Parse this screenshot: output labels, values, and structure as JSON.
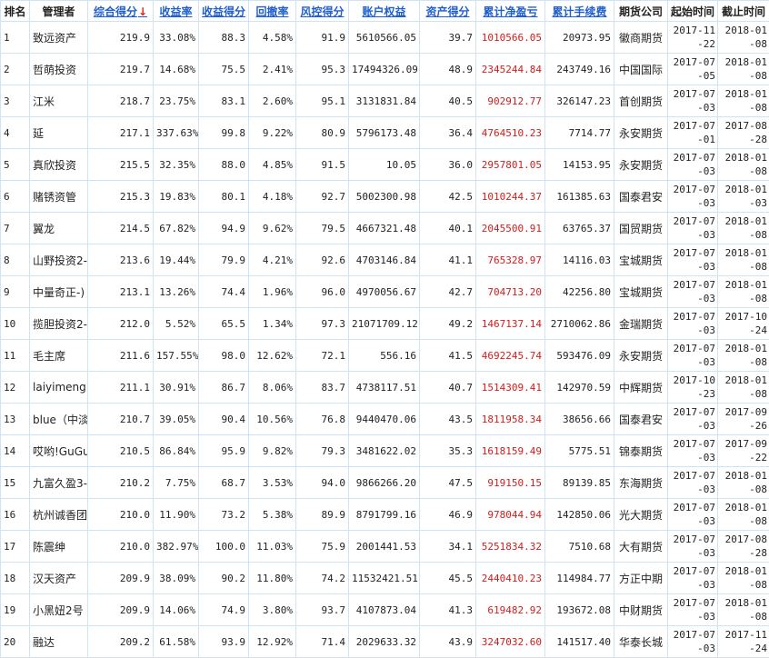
{
  "headers": [
    {
      "key": "rank",
      "label": "排名",
      "sortable": false
    },
    {
      "key": "manager",
      "label": "管理者",
      "sortable": false
    },
    {
      "key": "score",
      "label": "综合得分",
      "sortable": true,
      "arrow": "↓"
    },
    {
      "key": "return_rate",
      "label": "收益率",
      "sortable": true
    },
    {
      "key": "return_score",
      "label": "收益得分",
      "sortable": true
    },
    {
      "key": "drawdown",
      "label": "回撤率",
      "sortable": true
    },
    {
      "key": "risk_score",
      "label": "风控得分",
      "sortable": true
    },
    {
      "key": "account_equity",
      "label": "账户权益",
      "sortable": true
    },
    {
      "key": "asset_score",
      "label": "资产得分",
      "sortable": true
    },
    {
      "key": "cum_pnl",
      "label": "累计净盈亏",
      "sortable": true
    },
    {
      "key": "cum_fee",
      "label": "累计手续费",
      "sortable": true
    },
    {
      "key": "company",
      "label": "期货公司",
      "sortable": false
    },
    {
      "key": "start",
      "label": "起始时间",
      "sortable": false
    },
    {
      "key": "end",
      "label": "截止时间",
      "sortable": false
    }
  ],
  "rows": [
    {
      "rank": "1",
      "manager": "致远资产",
      "score": "219.9",
      "return_rate": "33.08%",
      "return_score": "88.3",
      "drawdown": "4.58%",
      "risk_score": "91.9",
      "account_equity": "5610566.05",
      "asset_score": "39.7",
      "cum_pnl": "1010566.05",
      "cum_fee": "20973.95",
      "company": "徽商期货",
      "start": "2017-11-22",
      "end": "2018-01-08"
    },
    {
      "rank": "2",
      "manager": "哲萌投资",
      "score": "219.7",
      "return_rate": "14.68%",
      "return_score": "75.5",
      "drawdown": "2.41%",
      "risk_score": "95.3",
      "account_equity": "17494326.09",
      "asset_score": "48.9",
      "cum_pnl": "2345244.84",
      "cum_fee": "243749.16",
      "company": "中国国际",
      "start": "2017-07-05",
      "end": "2018-01-08"
    },
    {
      "rank": "3",
      "manager": "江米",
      "score": "218.7",
      "return_rate": "23.75%",
      "return_score": "83.1",
      "drawdown": "2.60%",
      "risk_score": "95.1",
      "account_equity": "3131831.84",
      "asset_score": "40.5",
      "cum_pnl": "902912.77",
      "cum_fee": "326147.23",
      "company": "首创期货",
      "start": "2017-07-03",
      "end": "2018-01-08"
    },
    {
      "rank": "4",
      "manager": "延",
      "score": "217.1",
      "return_rate": "337.63%",
      "return_score": "99.8",
      "drawdown": "9.22%",
      "risk_score": "80.9",
      "account_equity": "5796173.48",
      "asset_score": "36.4",
      "cum_pnl": "4764510.23",
      "cum_fee": "7714.77",
      "company": "永安期货",
      "start": "2017-07-01",
      "end": "2017-08-28"
    },
    {
      "rank": "5",
      "manager": "真欣投资",
      "score": "215.5",
      "return_rate": "32.35%",
      "return_score": "88.0",
      "drawdown": "4.85%",
      "risk_score": "91.5",
      "account_equity": "10.05",
      "asset_score": "36.0",
      "cum_pnl": "2957801.05",
      "cum_fee": "14153.95",
      "company": "永安期货",
      "start": "2017-07-03",
      "end": "2018-01-08"
    },
    {
      "rank": "6",
      "manager": "赌锈资管",
      "score": "215.3",
      "return_rate": "19.83%",
      "return_score": "80.1",
      "drawdown": "4.18%",
      "risk_score": "92.7",
      "account_equity": "5002300.98",
      "asset_score": "42.5",
      "cum_pnl": "1010244.37",
      "cum_fee": "161385.63",
      "company": "国泰君安",
      "start": "2017-07-03",
      "end": "2018-01-03"
    },
    {
      "rank": "7",
      "manager": "翼龙",
      "score": "214.5",
      "return_rate": "67.82%",
      "return_score": "94.9",
      "drawdown": "9.62%",
      "risk_score": "79.5",
      "account_equity": "4667321.48",
      "asset_score": "40.1",
      "cum_pnl": "2045500.91",
      "cum_fee": "63765.37",
      "company": "国贸期货",
      "start": "2017-07-03",
      "end": "2018-01-08"
    },
    {
      "rank": "8",
      "manager": "山野投资2-",
      "score": "213.6",
      "return_rate": "19.44%",
      "return_score": "79.9",
      "drawdown": "4.21%",
      "risk_score": "92.6",
      "account_equity": "4703146.84",
      "asset_score": "41.1",
      "cum_pnl": "765328.97",
      "cum_fee": "14116.03",
      "company": "宝城期货",
      "start": "2017-07-03",
      "end": "2018-01-08"
    },
    {
      "rank": "9",
      "manager": "中量奇正-)",
      "score": "213.1",
      "return_rate": "13.26%",
      "return_score": "74.4",
      "drawdown": "1.96%",
      "risk_score": "96.0",
      "account_equity": "4970056.67",
      "asset_score": "42.7",
      "cum_pnl": "704713.20",
      "cum_fee": "42256.80",
      "company": "宝城期货",
      "start": "2017-07-03",
      "end": "2018-01-08"
    },
    {
      "rank": "10",
      "manager": "揽胆投资2-",
      "score": "212.0",
      "return_rate": "5.52%",
      "return_score": "65.5",
      "drawdown": "1.34%",
      "risk_score": "97.3",
      "account_equity": "21071709.12",
      "asset_score": "49.2",
      "cum_pnl": "1467137.14",
      "cum_fee": "2710062.86",
      "company": "金瑞期货",
      "start": "2017-07-03",
      "end": "2017-10-24"
    },
    {
      "rank": "11",
      "manager": "毛主席",
      "score": "211.6",
      "return_rate": "157.55%",
      "return_score": "98.0",
      "drawdown": "12.62%",
      "risk_score": "72.1",
      "account_equity": "556.16",
      "asset_score": "41.5",
      "cum_pnl": "4692245.74",
      "cum_fee": "593476.09",
      "company": "永安期货",
      "start": "2017-07-03",
      "end": "2018-01-08"
    },
    {
      "rank": "12",
      "manager": "laiyimeng.",
      "score": "211.1",
      "return_rate": "30.91%",
      "return_score": "86.7",
      "drawdown": "8.06%",
      "risk_score": "83.7",
      "account_equity": "4738117.51",
      "asset_score": "40.7",
      "cum_pnl": "1514309.41",
      "cum_fee": "142970.59",
      "company": "中辉期货",
      "start": "2017-10-23",
      "end": "2018-01-08"
    },
    {
      "rank": "13",
      "manager": "blue（中淡",
      "score": "210.7",
      "return_rate": "39.05%",
      "return_score": "90.4",
      "drawdown": "10.56%",
      "risk_score": "76.8",
      "account_equity": "9440470.06",
      "asset_score": "43.5",
      "cum_pnl": "1811958.34",
      "cum_fee": "38656.66",
      "company": "国泰君安",
      "start": "2017-07-03",
      "end": "2017-09-26"
    },
    {
      "rank": "14",
      "manager": "哎哟!GuGu",
      "score": "210.5",
      "return_rate": "86.84%",
      "return_score": "95.9",
      "drawdown": "9.82%",
      "risk_score": "79.3",
      "account_equity": "3481622.02",
      "asset_score": "35.3",
      "cum_pnl": "1618159.49",
      "cum_fee": "5775.51",
      "company": "锦泰期货",
      "start": "2017-07-03",
      "end": "2017-09-22"
    },
    {
      "rank": "15",
      "manager": "九富久盈3-",
      "score": "210.2",
      "return_rate": "7.75%",
      "return_score": "68.7",
      "drawdown": "3.53%",
      "risk_score": "94.0",
      "account_equity": "9866266.20",
      "asset_score": "47.5",
      "cum_pnl": "919150.15",
      "cum_fee": "89139.85",
      "company": "东海期货",
      "start": "2017-07-03",
      "end": "2018-01-08"
    },
    {
      "rank": "16",
      "manager": "杭州诚香团",
      "score": "210.0",
      "return_rate": "11.90%",
      "return_score": "73.2",
      "drawdown": "5.38%",
      "risk_score": "89.9",
      "account_equity": "8791799.16",
      "asset_score": "46.9",
      "cum_pnl": "978044.94",
      "cum_fee": "142850.06",
      "company": "光大期货",
      "start": "2017-07-03",
      "end": "2018-01-08"
    },
    {
      "rank": "17",
      "manager": "陈震绅",
      "score": "210.0",
      "return_rate": "382.97%",
      "return_score": "100.0",
      "drawdown": "11.03%",
      "risk_score": "75.9",
      "account_equity": "2001441.53",
      "asset_score": "34.1",
      "cum_pnl": "5251834.32",
      "cum_fee": "7510.68",
      "company": "大有期货",
      "start": "2017-07-03",
      "end": "2017-08-28"
    },
    {
      "rank": "18",
      "manager": "汉天资产",
      "score": "209.9",
      "return_rate": "38.09%",
      "return_score": "90.2",
      "drawdown": "11.80%",
      "risk_score": "74.2",
      "account_equity": "11532421.51",
      "asset_score": "45.5",
      "cum_pnl": "2440410.23",
      "cum_fee": "114984.77",
      "company": "方正中期",
      "start": "2017-07-03",
      "end": "2018-01-08"
    },
    {
      "rank": "19",
      "manager": "小黑妞2号",
      "score": "209.9",
      "return_rate": "14.06%",
      "return_score": "74.9",
      "drawdown": "3.80%",
      "risk_score": "93.7",
      "account_equity": "4107873.04",
      "asset_score": "41.3",
      "cum_pnl": "619482.92",
      "cum_fee": "193672.08",
      "company": "中财期货",
      "start": "2017-07-03",
      "end": "2018-01-08"
    },
    {
      "rank": "20",
      "manager": "融达",
      "score": "209.2",
      "return_rate": "61.58%",
      "return_score": "93.9",
      "drawdown": "12.92%",
      "risk_score": "71.4",
      "account_equity": "2029633.32",
      "asset_score": "43.9",
      "cum_pnl": "3247032.60",
      "cum_fee": "141517.40",
      "company": "华泰长城",
      "start": "2017-07-03",
      "end": "2017-11-24"
    }
  ]
}
